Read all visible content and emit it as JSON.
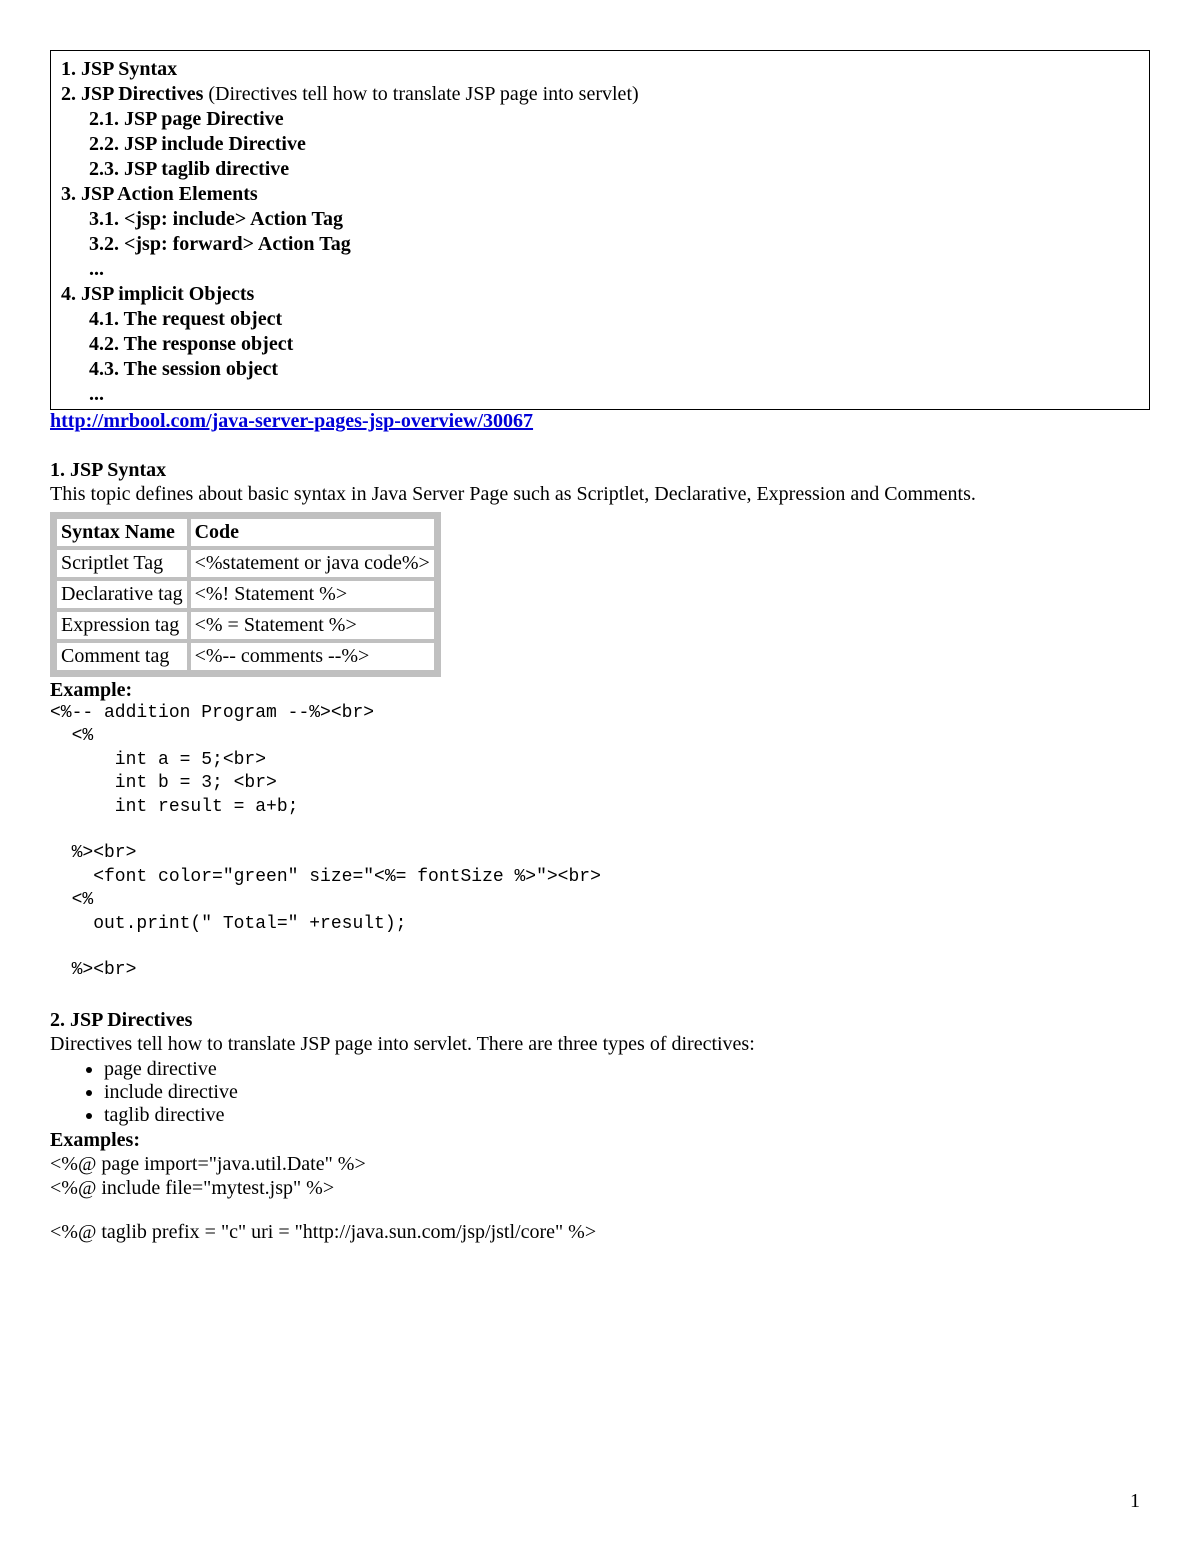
{
  "toc": {
    "i1": {
      "num": "1.",
      "title": "JSP Syntax"
    },
    "i2": {
      "num": "2.",
      "title": "JSP Directives",
      "note": "(Directives tell how to translate JSP page into servlet)"
    },
    "i2_1": "2.1. JSP page Directive",
    "i2_2": "2.2. JSP include Directive",
    "i2_3": "2.3. JSP taglib directive",
    "i3": {
      "num": "3.",
      "title": "JSP Action Elements"
    },
    "i3_1": "3.1. <jsp: include> Action Tag",
    "i3_2": "3.2. <jsp: forward> Action Tag",
    "i3_e": "...",
    "i4": {
      "num": "4.",
      "title": "JSP implicit Objects"
    },
    "i4_1": "4.1. The request object",
    "i4_2": "4.2. The response object",
    "i4_3": "4.3. The session object",
    "i4_e": "..."
  },
  "link": "http://mrbool.com/java-server-pages-jsp-overview/30067",
  "sec1": {
    "title": "1. JSP Syntax",
    "intro": "This topic defines about basic syntax in Java Server Page such as Scriptlet, Declarative, Expression and Comments.",
    "th1": "Syntax Name",
    "th2": "Code",
    "r1c1": "Scriptlet Tag",
    "r1c2": "<%statement or java code%>",
    "r2c1": "Declarative tag",
    "r2c2": "<%! Statement %>",
    "r3c1": "Expression tag",
    "r3c2": "<% = Statement %>",
    "r4c1": "Comment tag",
    "r4c2": "<%-- comments --%>",
    "example_label": "Example:",
    "code": "<%-- addition Program --%><br>\n  <%\n      int a = 5;<br>\n      int b = 3; <br>\n      int result = a+b;\n\n  %><br>\n    <font color=\"green\" size=\"<%= fontSize %>\"><br>\n  <%\n    out.print(\" Total=\" +result);\n\n  %><br>"
  },
  "sec2": {
    "title": "2. JSP Directives",
    "intro": "Directives tell how to translate JSP page into servlet. There are three types of directives:",
    "b1": "page directive",
    "b2": "include directive",
    "b3": "taglib directive",
    "examples_label": "Examples:",
    "ex1": "<%@ page import=\"java.util.Date\" %>",
    "ex2": "<%@ include file=\"mytest.jsp\" %>",
    "ex3": "<%@ taglib prefix = \"c\" uri = \"http://java.sun.com/jsp/jstl/core\" %>"
  },
  "page_number": "1"
}
